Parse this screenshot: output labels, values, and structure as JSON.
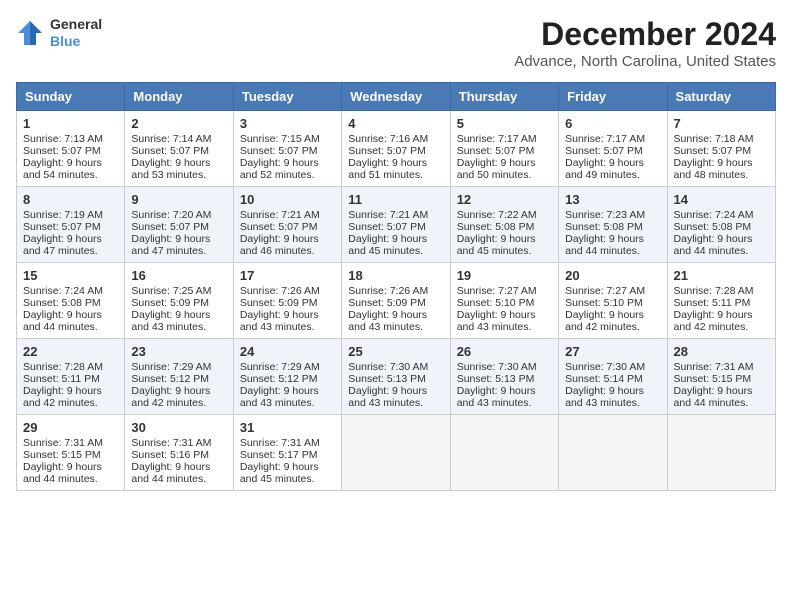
{
  "header": {
    "logo_line1": "General",
    "logo_line2": "Blue",
    "title": "December 2024",
    "subtitle": "Advance, North Carolina, United States"
  },
  "calendar": {
    "weekdays": [
      "Sunday",
      "Monday",
      "Tuesday",
      "Wednesday",
      "Thursday",
      "Friday",
      "Saturday"
    ],
    "weeks": [
      [
        {
          "day": "1",
          "sunrise": "7:13 AM",
          "sunset": "5:07 PM",
          "daylight": "9 hours and 54 minutes."
        },
        {
          "day": "2",
          "sunrise": "7:14 AM",
          "sunset": "5:07 PM",
          "daylight": "9 hours and 53 minutes."
        },
        {
          "day": "3",
          "sunrise": "7:15 AM",
          "sunset": "5:07 PM",
          "daylight": "9 hours and 52 minutes."
        },
        {
          "day": "4",
          "sunrise": "7:16 AM",
          "sunset": "5:07 PM",
          "daylight": "9 hours and 51 minutes."
        },
        {
          "day": "5",
          "sunrise": "7:17 AM",
          "sunset": "5:07 PM",
          "daylight": "9 hours and 50 minutes."
        },
        {
          "day": "6",
          "sunrise": "7:17 AM",
          "sunset": "5:07 PM",
          "daylight": "9 hours and 49 minutes."
        },
        {
          "day": "7",
          "sunrise": "7:18 AM",
          "sunset": "5:07 PM",
          "daylight": "9 hours and 48 minutes."
        }
      ],
      [
        {
          "day": "8",
          "sunrise": "7:19 AM",
          "sunset": "5:07 PM",
          "daylight": "9 hours and 47 minutes."
        },
        {
          "day": "9",
          "sunrise": "7:20 AM",
          "sunset": "5:07 PM",
          "daylight": "9 hours and 47 minutes."
        },
        {
          "day": "10",
          "sunrise": "7:21 AM",
          "sunset": "5:07 PM",
          "daylight": "9 hours and 46 minutes."
        },
        {
          "day": "11",
          "sunrise": "7:21 AM",
          "sunset": "5:07 PM",
          "daylight": "9 hours and 45 minutes."
        },
        {
          "day": "12",
          "sunrise": "7:22 AM",
          "sunset": "5:08 PM",
          "daylight": "9 hours and 45 minutes."
        },
        {
          "day": "13",
          "sunrise": "7:23 AM",
          "sunset": "5:08 PM",
          "daylight": "9 hours and 44 minutes."
        },
        {
          "day": "14",
          "sunrise": "7:24 AM",
          "sunset": "5:08 PM",
          "daylight": "9 hours and 44 minutes."
        }
      ],
      [
        {
          "day": "15",
          "sunrise": "7:24 AM",
          "sunset": "5:08 PM",
          "daylight": "9 hours and 44 minutes."
        },
        {
          "day": "16",
          "sunrise": "7:25 AM",
          "sunset": "5:09 PM",
          "daylight": "9 hours and 43 minutes."
        },
        {
          "day": "17",
          "sunrise": "7:26 AM",
          "sunset": "5:09 PM",
          "daylight": "9 hours and 43 minutes."
        },
        {
          "day": "18",
          "sunrise": "7:26 AM",
          "sunset": "5:09 PM",
          "daylight": "9 hours and 43 minutes."
        },
        {
          "day": "19",
          "sunrise": "7:27 AM",
          "sunset": "5:10 PM",
          "daylight": "9 hours and 43 minutes."
        },
        {
          "day": "20",
          "sunrise": "7:27 AM",
          "sunset": "5:10 PM",
          "daylight": "9 hours and 42 minutes."
        },
        {
          "day": "21",
          "sunrise": "7:28 AM",
          "sunset": "5:11 PM",
          "daylight": "9 hours and 42 minutes."
        }
      ],
      [
        {
          "day": "22",
          "sunrise": "7:28 AM",
          "sunset": "5:11 PM",
          "daylight": "9 hours and 42 minutes."
        },
        {
          "day": "23",
          "sunrise": "7:29 AM",
          "sunset": "5:12 PM",
          "daylight": "9 hours and 42 minutes."
        },
        {
          "day": "24",
          "sunrise": "7:29 AM",
          "sunset": "5:12 PM",
          "daylight": "9 hours and 43 minutes."
        },
        {
          "day": "25",
          "sunrise": "7:30 AM",
          "sunset": "5:13 PM",
          "daylight": "9 hours and 43 minutes."
        },
        {
          "day": "26",
          "sunrise": "7:30 AM",
          "sunset": "5:13 PM",
          "daylight": "9 hours and 43 minutes."
        },
        {
          "day": "27",
          "sunrise": "7:30 AM",
          "sunset": "5:14 PM",
          "daylight": "9 hours and 43 minutes."
        },
        {
          "day": "28",
          "sunrise": "7:31 AM",
          "sunset": "5:15 PM",
          "daylight": "9 hours and 44 minutes."
        }
      ],
      [
        {
          "day": "29",
          "sunrise": "7:31 AM",
          "sunset": "5:15 PM",
          "daylight": "9 hours and 44 minutes."
        },
        {
          "day": "30",
          "sunrise": "7:31 AM",
          "sunset": "5:16 PM",
          "daylight": "9 hours and 44 minutes."
        },
        {
          "day": "31",
          "sunrise": "7:31 AM",
          "sunset": "5:17 PM",
          "daylight": "9 hours and 45 minutes."
        },
        null,
        null,
        null,
        null
      ]
    ],
    "labels": {
      "sunrise": "Sunrise:",
      "sunset": "Sunset:",
      "daylight": "Daylight:"
    }
  }
}
